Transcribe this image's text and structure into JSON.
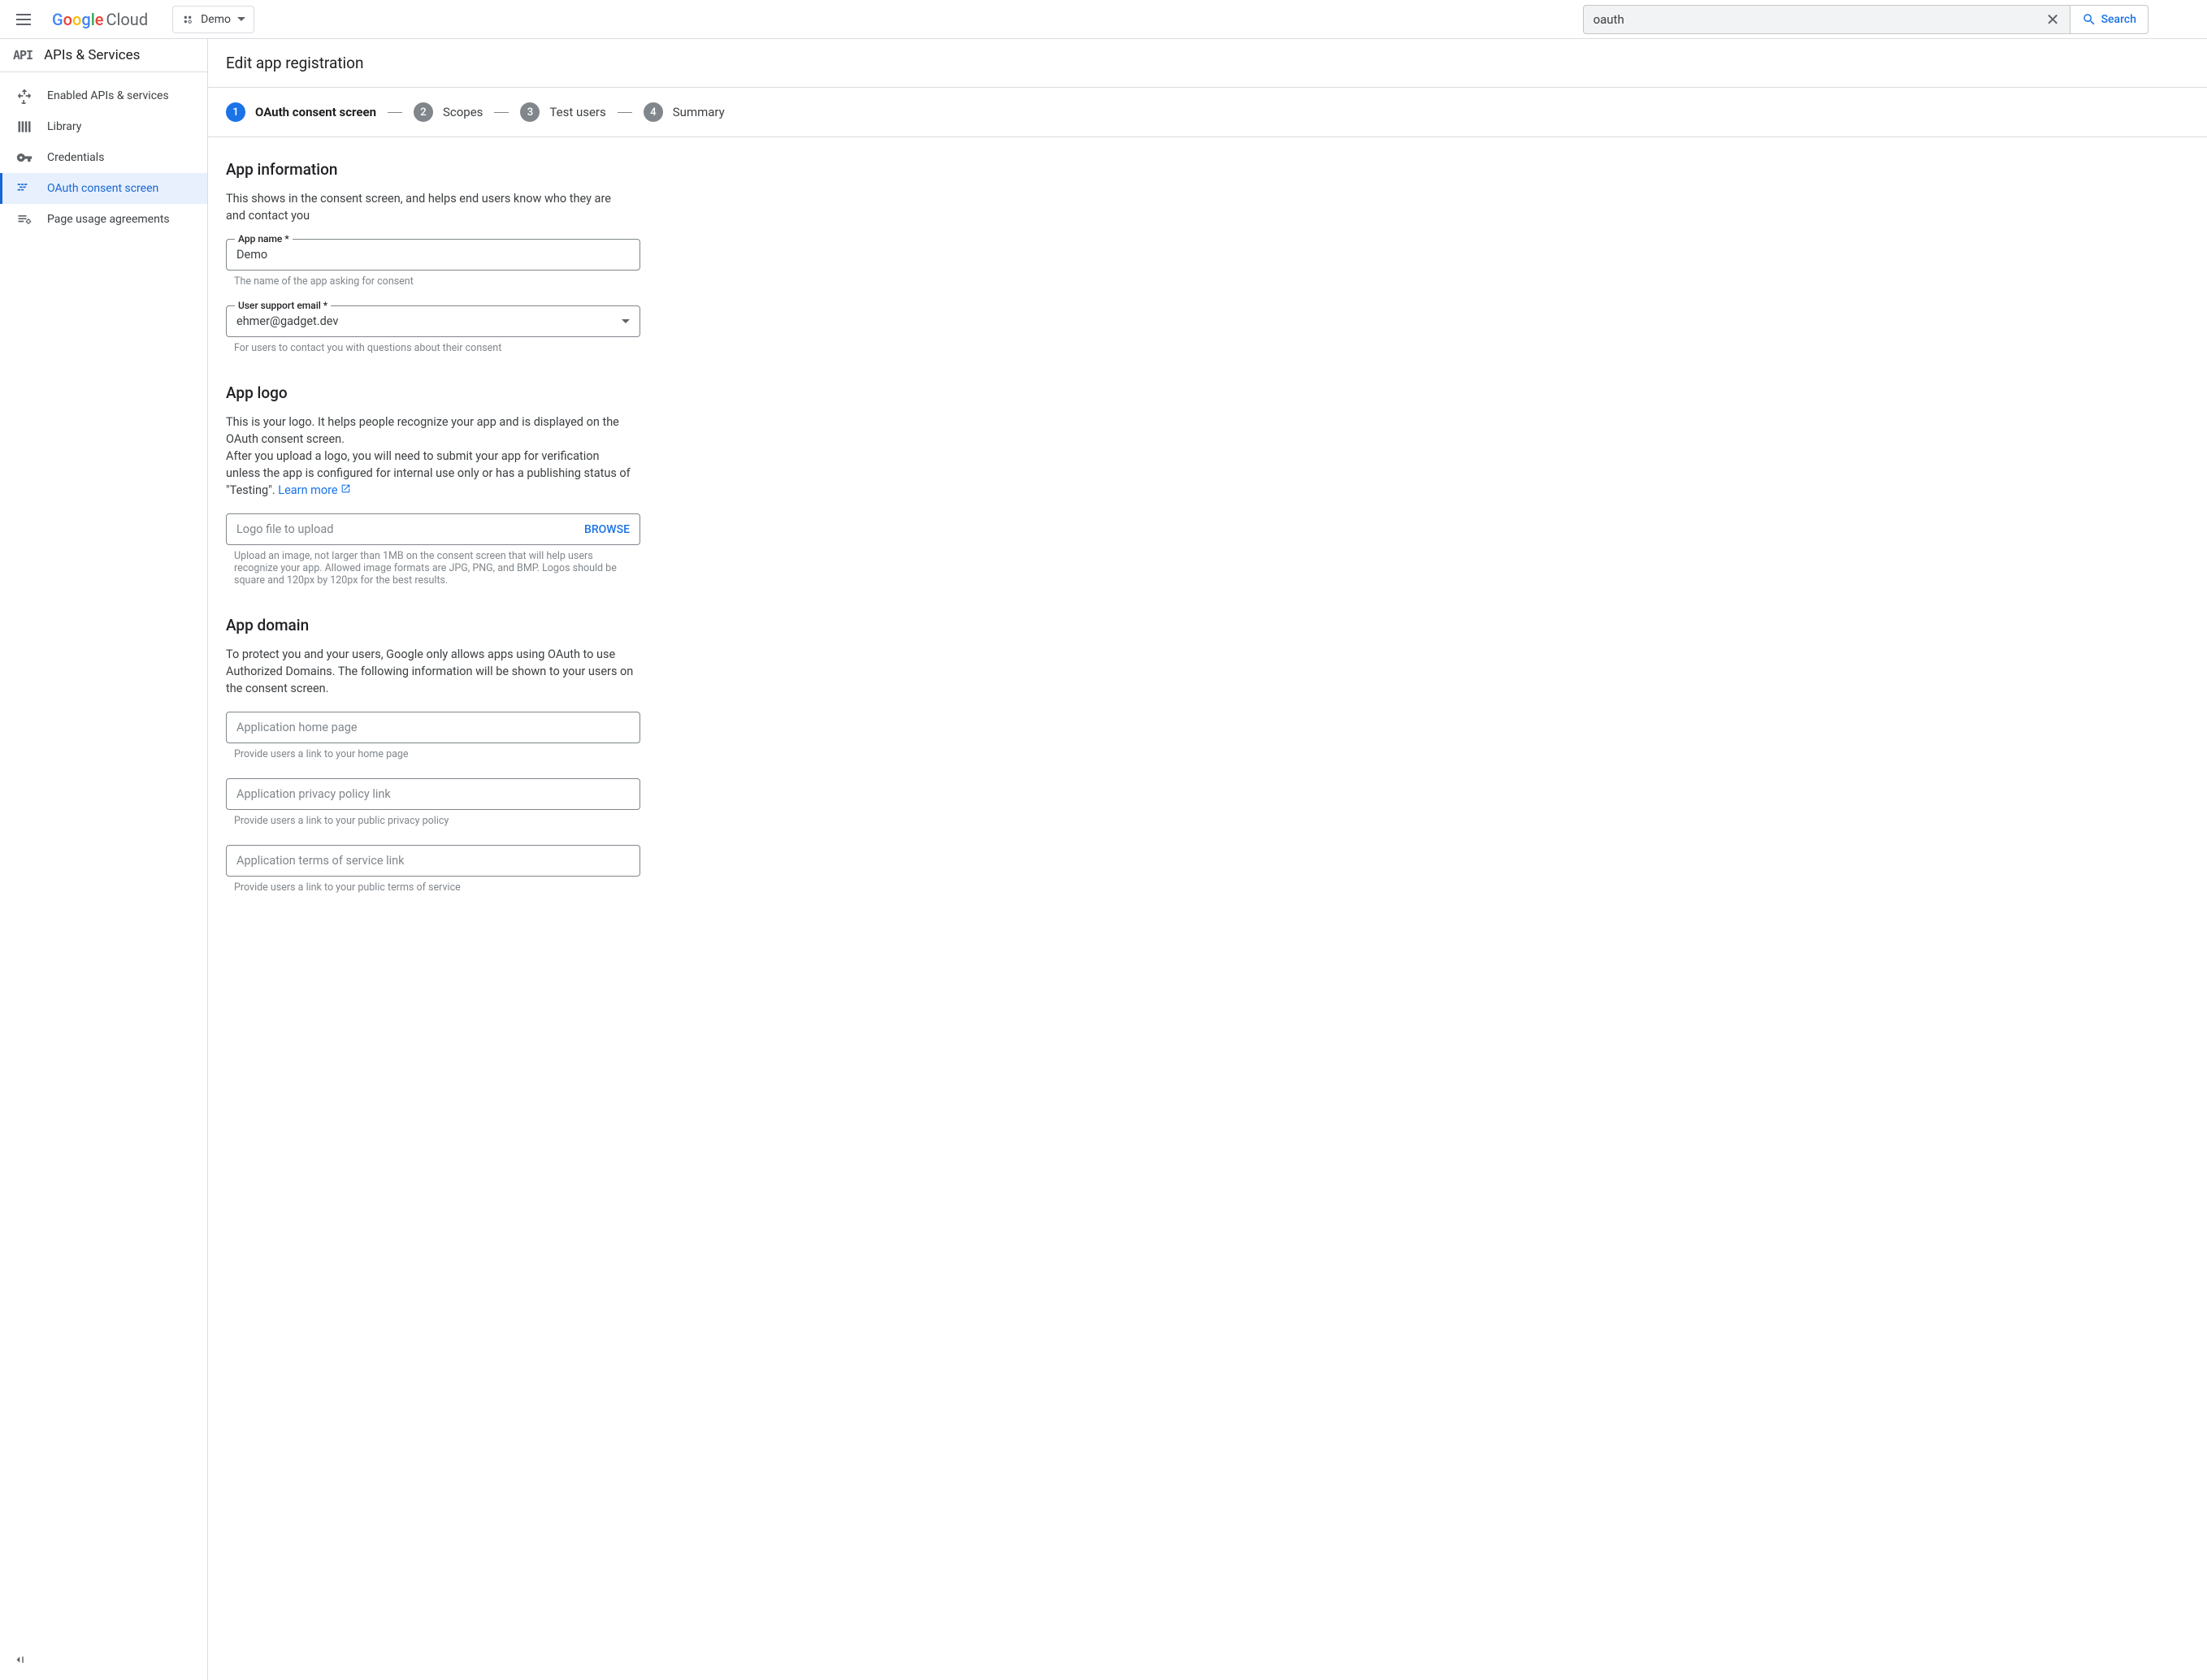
{
  "topbar": {
    "logo_google": "Google",
    "logo_cloud": "Cloud",
    "project_name": "Demo",
    "search_value": "oauth",
    "search_button": "Search"
  },
  "sidebar": {
    "header_icon": "API",
    "title": "APIs & Services",
    "items": [
      {
        "label": "Enabled APIs & services"
      },
      {
        "label": "Library"
      },
      {
        "label": "Credentials"
      },
      {
        "label": "OAuth consent screen"
      },
      {
        "label": "Page usage agreements"
      }
    ]
  },
  "page": {
    "title": "Edit app registration"
  },
  "stepper": [
    {
      "num": "1",
      "label": "OAuth consent screen"
    },
    {
      "num": "2",
      "label": "Scopes"
    },
    {
      "num": "3",
      "label": "Test users"
    },
    {
      "num": "4",
      "label": "Summary"
    }
  ],
  "sections": {
    "app_info": {
      "title": "App information",
      "desc": "This shows in the consent screen, and helps end users know who they are and contact you",
      "app_name_label": "App name *",
      "app_name_value": "Demo",
      "app_name_help": "The name of the app asking for consent",
      "support_email_label": "User support email *",
      "support_email_value": "ehmer@gadget.dev",
      "support_email_help": "For users to contact you with questions about their consent"
    },
    "app_logo": {
      "title": "App logo",
      "desc1": "This is your logo. It helps people recognize your app and is displayed on the OAuth consent screen.",
      "desc2": "After you upload a logo, you will need to submit your app for verification unless the app is configured for internal use only or has a publishing status of \"Testing\". ",
      "learn_more": "Learn more",
      "upload_label": "Logo file to upload",
      "browse": "BROWSE",
      "upload_help": "Upload an image, not larger than 1MB on the consent screen that will help users recognize your app. Allowed image formats are JPG, PNG, and BMP. Logos should be square and 120px by 120px for the best results."
    },
    "app_domain": {
      "title": "App domain",
      "desc": "To protect you and your users, Google only allows apps using OAuth to use Authorized Domains. The following information will be shown to your users on the consent screen.",
      "home_page_label": "Application home page",
      "home_page_help": "Provide users a link to your home page",
      "privacy_label": "Application privacy policy link",
      "privacy_help": "Provide users a link to your public privacy policy",
      "tos_label": "Application terms of service link",
      "tos_help": "Provide users a link to your public terms of service"
    }
  }
}
